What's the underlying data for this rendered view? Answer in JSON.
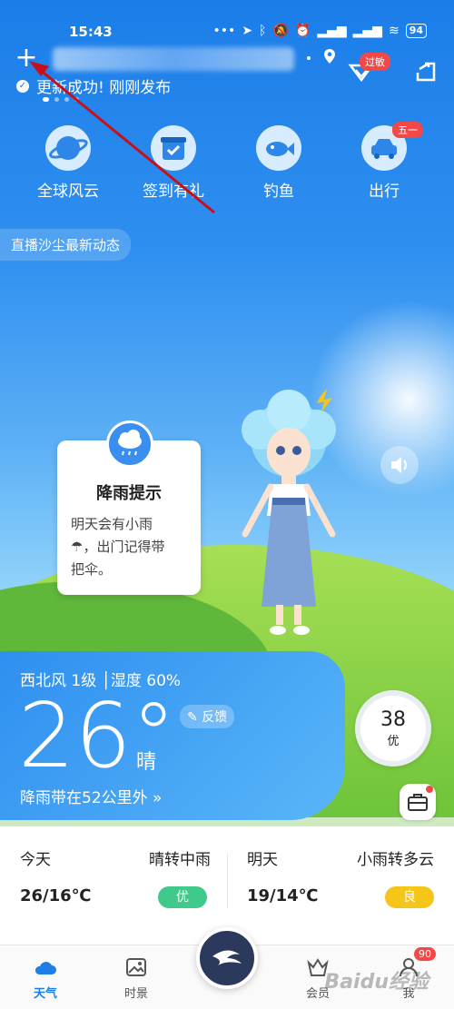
{
  "status": {
    "time": "15:43",
    "battery": "94"
  },
  "header": {
    "allergy_badge": "过敏",
    "update_text": "更新成功! 刚刚发布"
  },
  "quick_nav": [
    {
      "label": "全球风云",
      "badge": ""
    },
    {
      "label": "签到有礼",
      "badge": ""
    },
    {
      "label": "钓鱼",
      "badge": ""
    },
    {
      "label": "出行",
      "badge": "五一"
    }
  ],
  "live_banner": "直播沙尘最新动态",
  "tip": {
    "title": "降雨提示",
    "body_1": "明天会有小雨",
    "body_2": "，出门记得带",
    "body_3": "把伞。"
  },
  "weather": {
    "wind_humidity": "西北风 1级 │湿度 60%",
    "temperature": "26°",
    "condition": "晴",
    "feedback": "反馈",
    "rain_distance": "降雨带在52公里外 »"
  },
  "aqi": {
    "value": "38",
    "level": "优"
  },
  "forecast": {
    "today": {
      "day": "今天",
      "condition": "晴转中雨",
      "range": "26/16℃",
      "aqi": "优",
      "aqi_color": "#3fc98a"
    },
    "tomorrow": {
      "day": "明天",
      "condition": "小雨转多云",
      "range": "19/14℃",
      "aqi": "良",
      "aqi_color": "#f5c518"
    }
  },
  "tabs": {
    "weather": "天气",
    "scenery": "时景",
    "vip": "会员",
    "me": "我",
    "me_badge": "90"
  },
  "watermark": "Baidu经验",
  "colors": {
    "accent": "#1e7de6",
    "badge_red": "#f24848"
  }
}
